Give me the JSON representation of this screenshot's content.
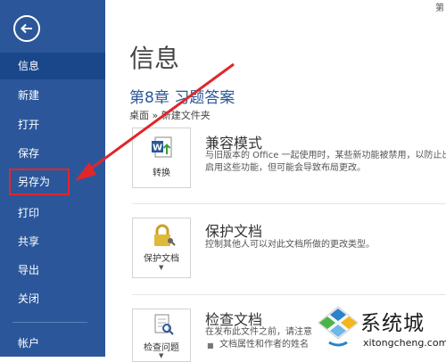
{
  "sidebar": {
    "items": [
      {
        "label": "信息"
      },
      {
        "label": "新建"
      },
      {
        "label": "打开"
      },
      {
        "label": "保存"
      },
      {
        "label": "另存为"
      },
      {
        "label": "打印"
      },
      {
        "label": "共享"
      },
      {
        "label": "导出"
      },
      {
        "label": "关闭"
      },
      {
        "label": "帐户"
      }
    ]
  },
  "main": {
    "page_title": "信息",
    "doc_title": "第8章 习题答案",
    "breadcrumb": "桌面 » 新建文件夹",
    "corner_text": "第",
    "sections": [
      {
        "button_label": "转换",
        "title": "兼容模式",
        "desc_line1": "与旧版本的 Office 一起使用时，某些新功能被禁用，以防止出",
        "desc_line2": "启用这些功能，但可能会导致布局更改。"
      },
      {
        "button_label": "保护文档",
        "title": "保护文档",
        "desc_line1": "控制其他人可以对此文档所做的更改类型。"
      },
      {
        "button_label": "检查问题",
        "title": "检查文档",
        "desc_line1": "在发布此文件之前，请注意",
        "bullet1": "文档属性和作者的姓名"
      }
    ]
  },
  "watermark": {
    "cn": "系统城",
    "url": "xitongcheng.com"
  },
  "colors": {
    "sidebar_bg": "#2b579a",
    "sidebar_active": "#19478a",
    "accent_title": "#2b579a",
    "annotation_red": "#e0262b"
  }
}
